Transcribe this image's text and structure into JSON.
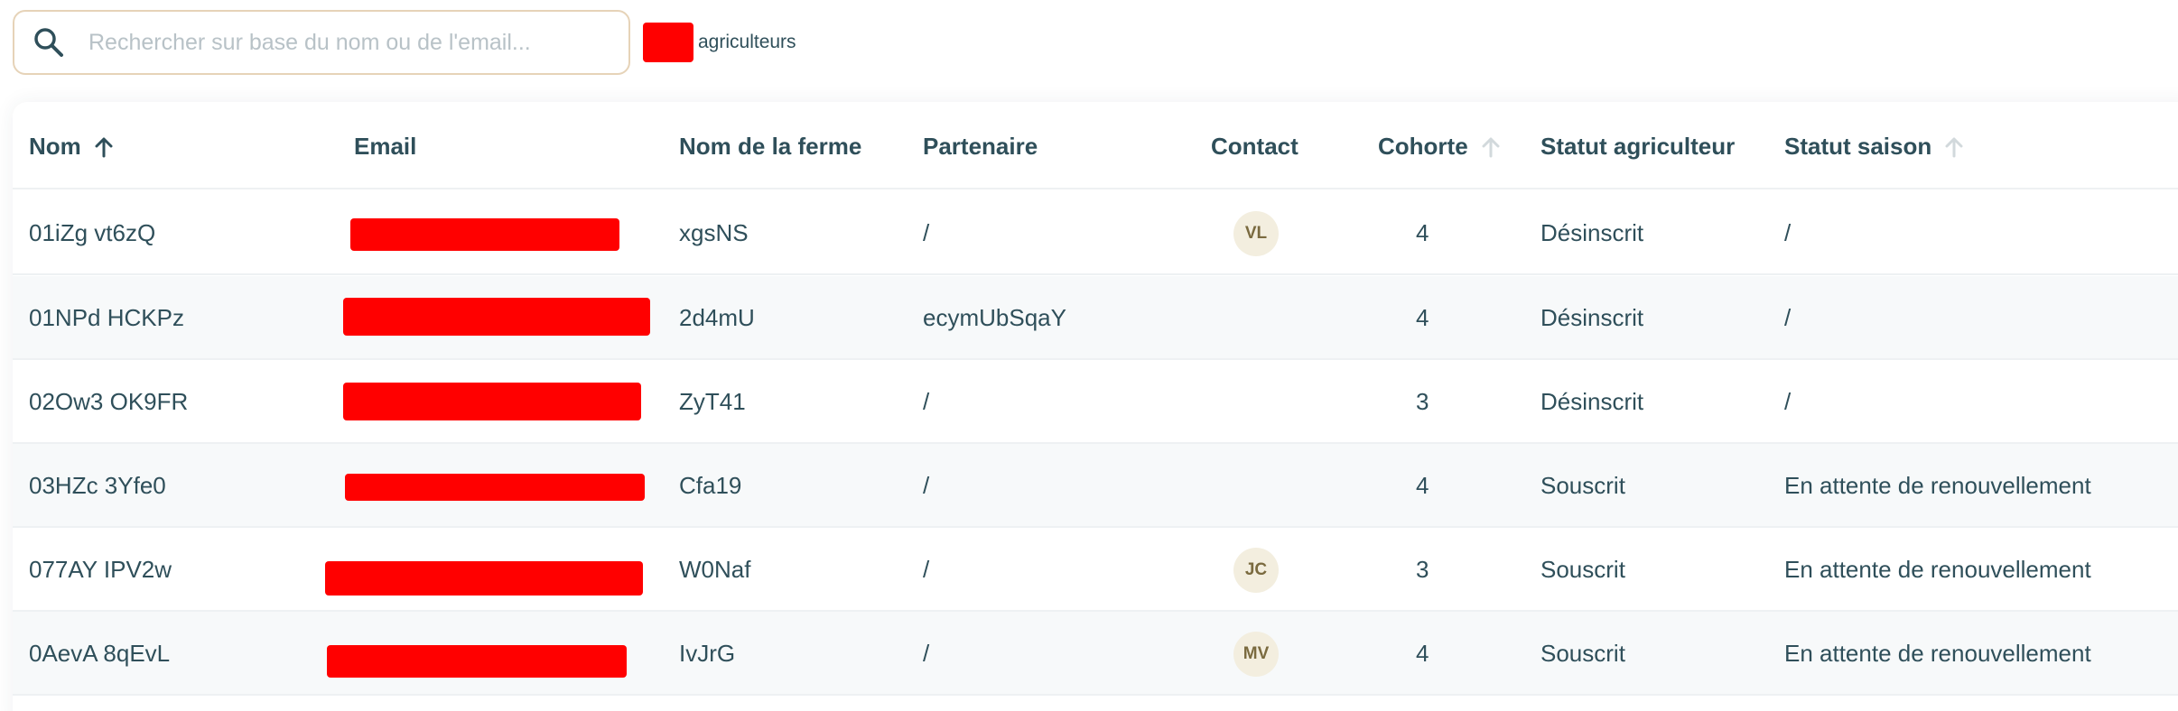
{
  "search": {
    "placeholder": "Rechercher sur base du nom ou de l'email...",
    "value": ""
  },
  "count": {
    "label": "agriculteurs"
  },
  "table": {
    "columns": [
      {
        "key": "nom",
        "label": "Nom",
        "sort": "asc-active"
      },
      {
        "key": "email",
        "label": "Email"
      },
      {
        "key": "ferme",
        "label": "Nom de la ferme"
      },
      {
        "key": "partenaire",
        "label": "Partenaire"
      },
      {
        "key": "contact",
        "label": "Contact"
      },
      {
        "key": "cohorte",
        "label": "Cohorte",
        "sort": "inactive"
      },
      {
        "key": "statut_agri",
        "label": "Statut agriculteur"
      },
      {
        "key": "statut_saison",
        "label": "Statut saison",
        "sort": "inactive"
      }
    ],
    "rows": [
      {
        "nom": "01iZg vt6zQ",
        "email": "",
        "ferme": "xgsNS",
        "partenaire": "/",
        "contact": "VL",
        "cohorte": "4",
        "statut_agri": "Désinscrit",
        "statut_saison": "/"
      },
      {
        "nom": "01NPd HCKPz",
        "email": "",
        "ferme": "2d4mU",
        "partenaire": "ecymUbSqaY",
        "contact": "",
        "cohorte": "4",
        "statut_agri": "Désinscrit",
        "statut_saison": "/"
      },
      {
        "nom": "02Ow3 OK9FR",
        "email": "",
        "ferme": "ZyT41",
        "partenaire": "/",
        "contact": "",
        "cohorte": "3",
        "statut_agri": "Désinscrit",
        "statut_saison": "/"
      },
      {
        "nom": "03HZc 3Yfe0",
        "email": "",
        "ferme": "Cfa19",
        "partenaire": "/",
        "contact": "",
        "cohorte": "4",
        "statut_agri": "Souscrit",
        "statut_saison": "En attente de renouvellement"
      },
      {
        "nom": "077AY IPV2w",
        "email": "",
        "ferme": "W0Naf",
        "partenaire": "/",
        "contact": "JC",
        "cohorte": "3",
        "statut_agri": "Souscrit",
        "statut_saison": "En attente de renouvellement"
      },
      {
        "nom": "0AevA 8qEvL",
        "email": "",
        "ferme": "IvJrG",
        "partenaire": "/",
        "contact": "MV",
        "cohorte": "4",
        "statut_agri": "Souscrit",
        "statut_saison": "En attente de renouvellement"
      }
    ]
  },
  "colors": {
    "text": "#2f4f5a",
    "redaction": "#ff0000",
    "avatar_bg": "#f3eedf",
    "search_border": "#e6d3b8",
    "row_alt": "#f7f9fa"
  },
  "icons": {
    "search": "search-icon",
    "sort_active": "arrow-up-icon",
    "sort_inactive": "arrow-up-faded-icon"
  }
}
